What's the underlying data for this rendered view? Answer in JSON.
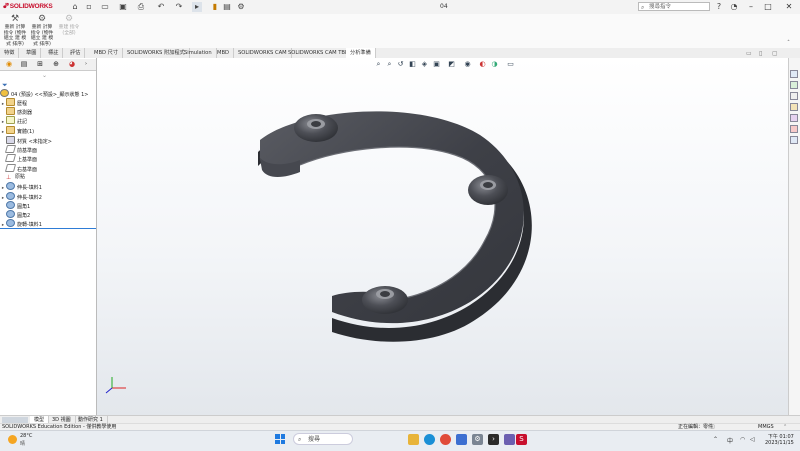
{
  "app": {
    "logo_text": "SOLIDWORKS",
    "window_title": "04"
  },
  "search": {
    "placeholder": "搜尋指令"
  },
  "ribbon": {
    "btn1": "重新 計算 指令 (物件 組立 建 模式 排序)",
    "btn2": "重新 計算 指令 (物件 組立 建 模式 排序)",
    "btn3": "重建 指令 (全部)"
  },
  "tabs": [
    "特徵",
    "草圖",
    "標註",
    "評估",
    "MBD 尺寸",
    "SOLIDWORKS 附加程式",
    "Simulation",
    "MBD",
    "SOLIDWORKS CAM",
    "SOLIDWORKS CAM TBM",
    "分析準備"
  ],
  "tree": {
    "root": "04 (預設) <<預設>_顯示狀態 1>",
    "items": [
      "歷程",
      "感測器",
      "註記",
      "實體(1)",
      "材質 <未指定>",
      "前基準面",
      "上基準面",
      "右基準面",
      "原點",
      "伸長-填料1",
      "伸長-填料2",
      "圓角1",
      "圓角2",
      "旋轉-填料1"
    ]
  },
  "bottom_tabs": [
    "模型",
    "3D 視圖",
    "動作研究 1"
  ],
  "status": {
    "left": "SOLIDWORKS Education Edition - 僅供教學使用",
    "editing": "正在編輯：零件",
    "units": "MMGS"
  },
  "taskbar": {
    "weather_temp": "28°C",
    "weather_desc": "晴",
    "search_placeholder": "搜尋",
    "time": "下午 01:07",
    "date": "2023/11/15"
  },
  "colors": {
    "accent": "#c8102e",
    "part": "#3d3f45",
    "selection_line": "#2e7cd6"
  },
  "icons": [
    "home-icon",
    "new-icon",
    "open-icon",
    "save-icon",
    "print-icon",
    "undo-icon",
    "redo-icon",
    "select-icon",
    "options-icon"
  ]
}
